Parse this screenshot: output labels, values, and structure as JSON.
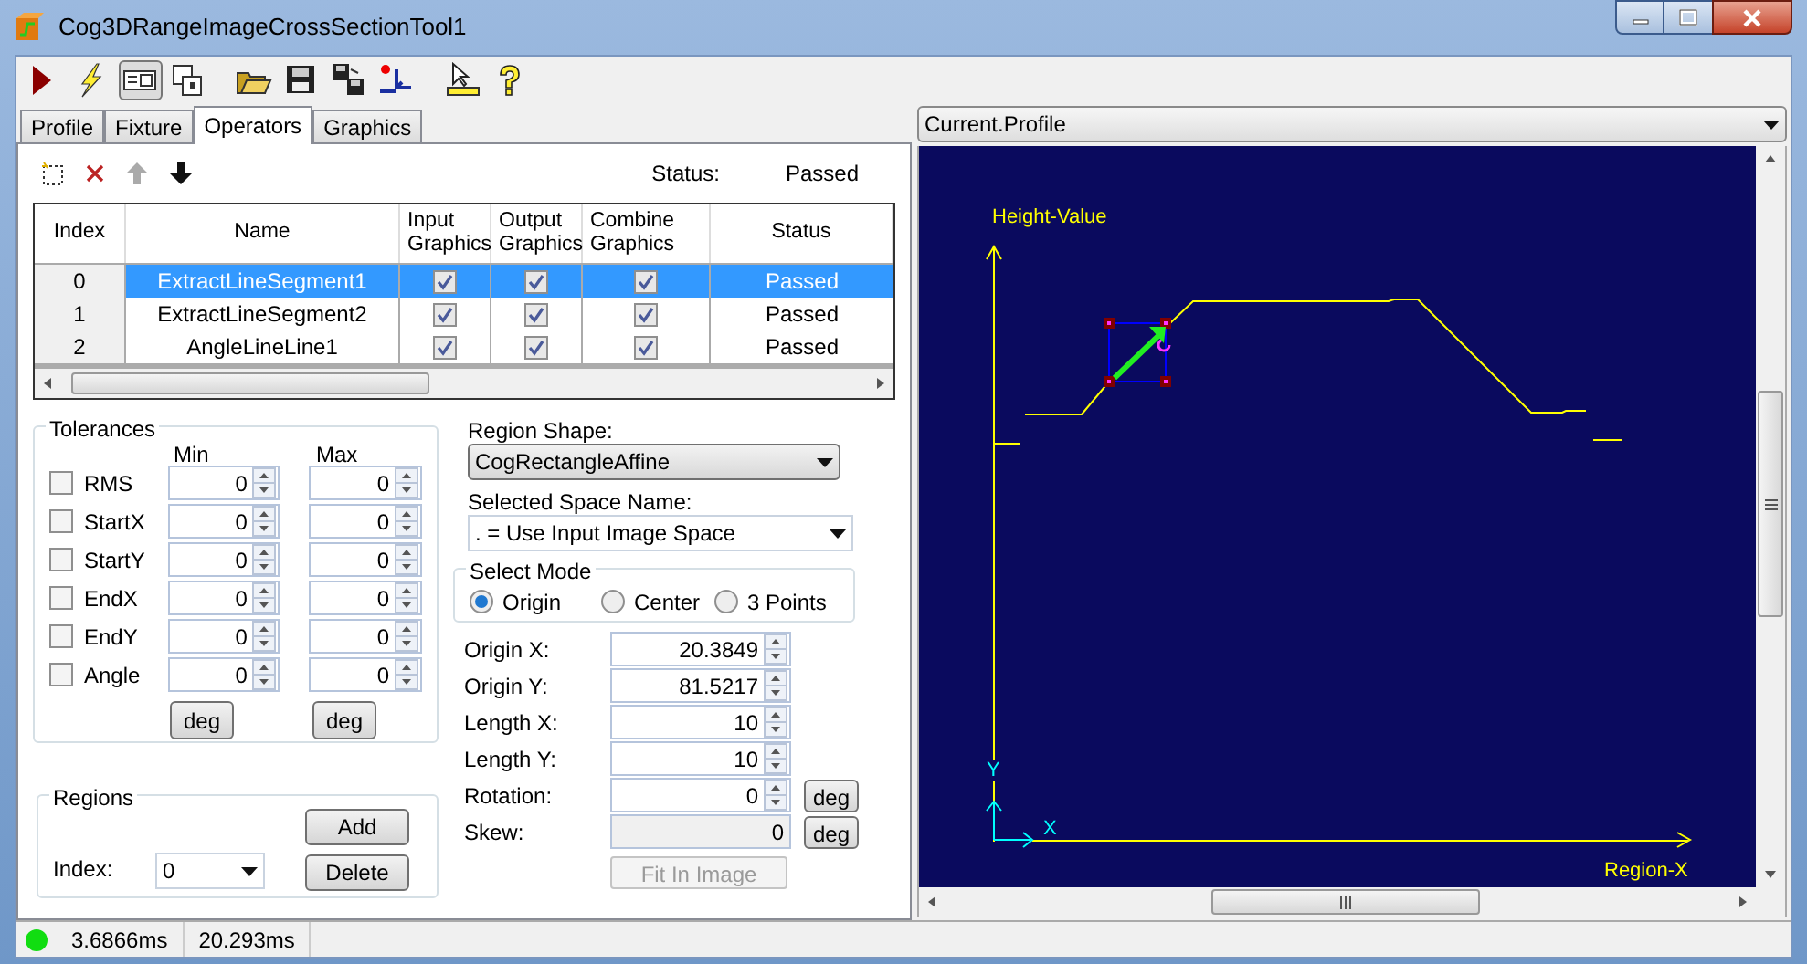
{
  "window": {
    "title": "Cog3DRangeImageCrossSectionTool1"
  },
  "toolbar": [
    {
      "pressed": false
    },
    {
      "pressed": false
    },
    {
      "pressed": true
    },
    {
      "pressed": false
    },
    {
      "pressed": false
    },
    {
      "pressed": false
    },
    {
      "pressed": false
    },
    {
      "pressed": false
    },
    {
      "pressed": false
    },
    {
      "pressed": false
    }
  ],
  "tabs": [
    {
      "label": "Profile",
      "selected": false
    },
    {
      "label": "Fixture",
      "selected": false
    },
    {
      "label": "Operators",
      "selected": true
    },
    {
      "label": "Graphics",
      "selected": false
    }
  ],
  "operators": {
    "status_label": "Status:",
    "status_value": "Passed",
    "columns": [
      "Index",
      "Name",
      "Input Graphics",
      "Output Graphics",
      "Combine Graphics",
      "Status"
    ],
    "rows": [
      {
        "index": "0",
        "name": "ExtractLineSegment1",
        "input_graphics": true,
        "output_graphics": true,
        "combine_graphics": true,
        "status": "Passed",
        "selected": true
      },
      {
        "index": "1",
        "name": "ExtractLineSegment2",
        "input_graphics": true,
        "output_graphics": true,
        "combine_graphics": true,
        "status": "Passed",
        "selected": false
      },
      {
        "index": "2",
        "name": "AngleLineLine1",
        "input_graphics": true,
        "output_graphics": true,
        "combine_graphics": true,
        "status": "Passed",
        "selected": false
      }
    ]
  },
  "tolerances": {
    "title": "Tolerances",
    "min_label": "Min",
    "max_label": "Max",
    "rows": [
      {
        "label": "RMS",
        "checked": false,
        "min": "0",
        "max": "0"
      },
      {
        "label": "StartX",
        "checked": false,
        "min": "0",
        "max": "0"
      },
      {
        "label": "StartY",
        "checked": false,
        "min": "0",
        "max": "0"
      },
      {
        "label": "EndX",
        "checked": false,
        "min": "0",
        "max": "0"
      },
      {
        "label": "EndY",
        "checked": false,
        "min": "0",
        "max": "0"
      },
      {
        "label": "Angle",
        "checked": false,
        "min": "0",
        "max": "0"
      }
    ],
    "unit_buttons": [
      "deg",
      "deg"
    ]
  },
  "regions": {
    "title": "Regions",
    "add": "Add",
    "delete": "Delete",
    "index_label": "Index:",
    "index_value": "0"
  },
  "region_shape": {
    "label": "Region Shape:",
    "value": "CogRectangleAffine"
  },
  "space_name": {
    "label": "Selected Space Name:",
    "value": ". = Use Input Image Space"
  },
  "select_mode": {
    "title": "Select Mode",
    "options": [
      {
        "label": "Origin",
        "selected": true
      },
      {
        "label": "Center",
        "selected": false
      },
      {
        "label": "3 Points",
        "selected": false
      }
    ]
  },
  "params": [
    {
      "label": "Origin X:",
      "value": "20.3849",
      "kind": "spin"
    },
    {
      "label": "Origin Y:",
      "value": "81.5217",
      "kind": "spin"
    },
    {
      "label": "Length X:",
      "value": "10",
      "kind": "spin"
    },
    {
      "label": "Length Y:",
      "value": "10",
      "kind": "spin"
    },
    {
      "label": "Rotation:",
      "value": "0",
      "kind": "spin",
      "unit": "deg"
    },
    {
      "label": "Skew:",
      "value": "0",
      "kind": "readonly",
      "unit": "deg"
    }
  ],
  "fit_button": {
    "label": "Fit In Image",
    "disabled": true
  },
  "display": {
    "selector": "Current.Profile",
    "y_axis_label": "Height-Value",
    "x_axis_label": "Region-X",
    "x_marker": "X",
    "y_marker": "Y"
  },
  "status_bar": {
    "passed": true,
    "times": [
      "3.6866ms",
      "20.293ms"
    ]
  }
}
